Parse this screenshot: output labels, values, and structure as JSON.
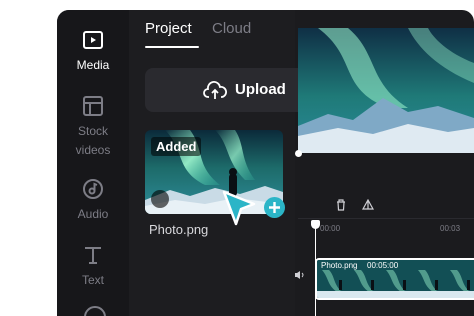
{
  "sidebar": {
    "items": [
      {
        "label": "Media",
        "icon": "media-icon",
        "active": true
      },
      {
        "label": "Stock\nvideos",
        "icon": "stock-videos-icon"
      },
      {
        "label": "Audio",
        "icon": "audio-icon"
      },
      {
        "label": "Text",
        "icon": "text-icon"
      }
    ]
  },
  "panel": {
    "tabs": [
      {
        "label": "Project",
        "active": true
      },
      {
        "label": "Cloud"
      }
    ],
    "upload_label": "Upload",
    "media_item": {
      "badge": "Added",
      "filename": "Photo.png"
    }
  },
  "timeline": {
    "ruler": [
      "00:00",
      "00:03"
    ],
    "clip": {
      "name": "Photo.png",
      "duration": "00:05:00"
    }
  },
  "colors": {
    "accent": "#2bb5c7",
    "background": "#1b1b1e",
    "sidebar": "#17171a"
  }
}
